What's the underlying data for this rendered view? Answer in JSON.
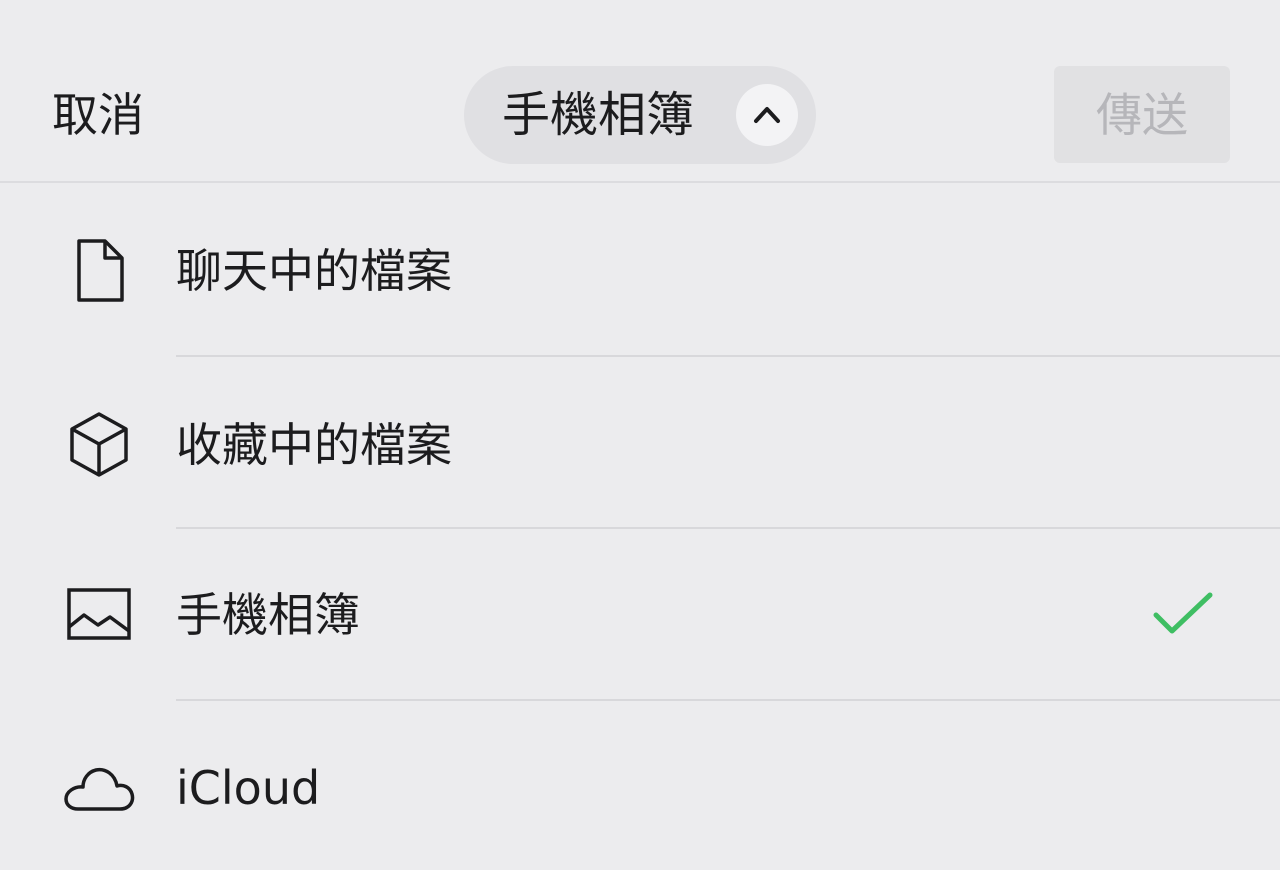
{
  "header": {
    "cancel_label": "取消",
    "source_title": "手機相簿",
    "send_label": "傳送"
  },
  "menu": {
    "items": [
      {
        "label": "聊天中的檔案",
        "icon": "document-icon",
        "selected": false
      },
      {
        "label": "收藏中的檔案",
        "icon": "cube-icon",
        "selected": false
      },
      {
        "label": "手機相簿",
        "icon": "photo-icon",
        "selected": true
      },
      {
        "label": "iCloud",
        "icon": "cloud-icon",
        "selected": false
      }
    ]
  },
  "colors": {
    "background": "#ececee",
    "text": "#1c1c1e",
    "disabled_text": "#b6b6ba",
    "check": "#3fbe63"
  }
}
